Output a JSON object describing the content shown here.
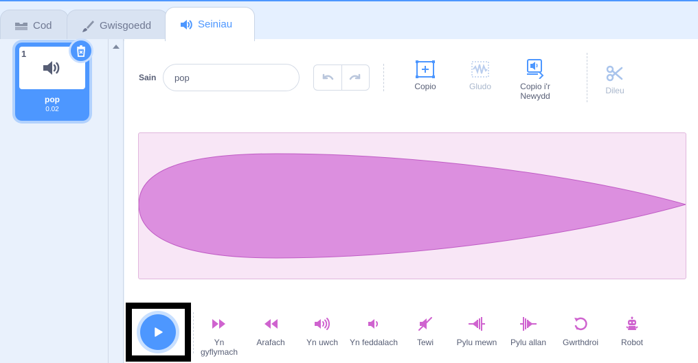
{
  "tabs": [
    {
      "label": "Cod",
      "icon": "code-blocks-icon"
    },
    {
      "label": "Gwisgoedd",
      "icon": "brush-icon"
    },
    {
      "label": "Seiniau",
      "icon": "speaker-icon",
      "active": true
    }
  ],
  "sound_list": {
    "items": [
      {
        "number": "1",
        "name": "pop",
        "duration": "0.02",
        "selected": true
      }
    ]
  },
  "editor": {
    "name_label": "Sain",
    "name_value": "pop",
    "tools": {
      "copy": "Copio",
      "paste": "Gludo",
      "copy_new": "Copio i'r Newydd",
      "delete": "Dileu"
    }
  },
  "effects": [
    {
      "label": "Yn gyflymach",
      "icon": "faster-icon"
    },
    {
      "label": "Arafach",
      "icon": "slower-icon"
    },
    {
      "label": "Yn uwch",
      "icon": "louder-icon"
    },
    {
      "label": "Yn feddalach",
      "icon": "softer-icon"
    },
    {
      "label": "Tewi",
      "icon": "mute-icon"
    },
    {
      "label": "Pylu mewn",
      "icon": "fade-in-icon"
    },
    {
      "label": "Pylu allan",
      "icon": "fade-out-icon"
    },
    {
      "label": "Gwrthdroi",
      "icon": "reverse-icon"
    },
    {
      "label": "Robot",
      "icon": "robot-icon"
    }
  ],
  "colors": {
    "accent": "#4d97ff",
    "sound": "#cf63cf",
    "wave_fill": "#dc8fdf",
    "wave_bg": "#f8e6f6"
  }
}
